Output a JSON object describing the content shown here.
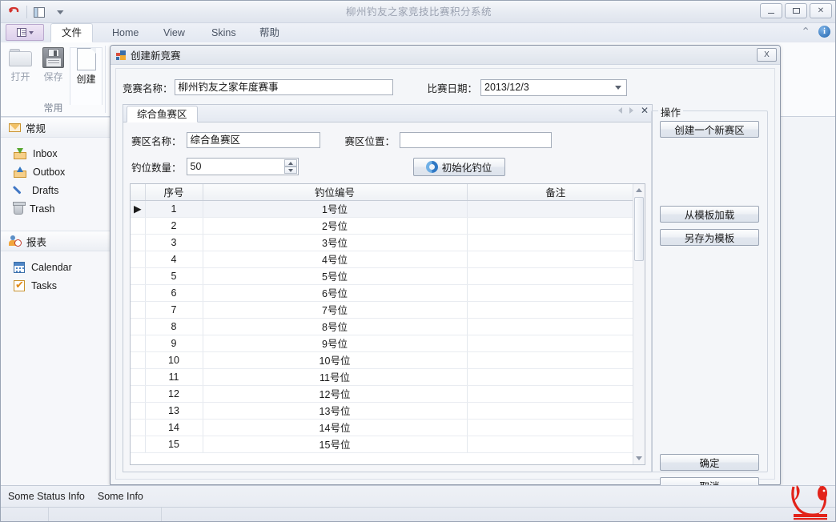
{
  "window": {
    "title": "柳州钓友之家竞技比赛积分系统",
    "minimize_label": "_",
    "maximize_label": "□",
    "close_label": "✕"
  },
  "quick_access": {
    "undo_icon": "undo-icon",
    "window_icon": "window-icon",
    "more_icon": "chevron-down-icon"
  },
  "ribbon": {
    "app_menu_label": "",
    "tabs": [
      {
        "label": "文件",
        "active": true
      },
      {
        "label": "Home",
        "active": false
      },
      {
        "label": "View",
        "active": false
      },
      {
        "label": "Skins",
        "active": false
      },
      {
        "label": "帮助",
        "active": false
      }
    ],
    "collapse_icon": "chevron-up-icon",
    "help_icon": "info-icon",
    "group": {
      "title": "常用",
      "items": [
        {
          "label": "打开",
          "icon": "folder-open-icon",
          "enabled": false
        },
        {
          "label": "保存",
          "icon": "floppy-disk-icon",
          "enabled": false
        },
        {
          "label": "创建",
          "icon": "new-page-icon",
          "enabled": true
        }
      ]
    }
  },
  "navpane": {
    "groups": [
      {
        "header": "常规",
        "header_icon": "envelope-icon",
        "items": [
          {
            "label": "Inbox",
            "icon": "inbox-icon"
          },
          {
            "label": "Outbox",
            "icon": "outbox-icon"
          },
          {
            "label": "Drafts",
            "icon": "pencil-icon"
          },
          {
            "label": "Trash",
            "icon": "trash-icon"
          }
        ]
      },
      {
        "header": "报表",
        "header_icon": "user-clock-icon",
        "items": [
          {
            "label": "Calendar",
            "icon": "calendar-icon"
          },
          {
            "label": "Tasks",
            "icon": "checkbox-icon"
          }
        ]
      }
    ]
  },
  "dialog": {
    "title": "创建新竞赛",
    "icon": "window-form-icon",
    "close_label": "X",
    "fields": {
      "contest_name_label": "竞赛名称：",
      "contest_name_value": "柳州钓友之家年度赛事",
      "match_date_label": "比赛日期：",
      "match_date_value": "2013/12/3"
    },
    "tabs": [
      {
        "label": "综合鱼赛区",
        "active": true
      }
    ],
    "tab_nav": {
      "prev_icon": "chevron-left-icon",
      "next_icon": "chevron-right-icon",
      "close_icon": "close-icon"
    },
    "zone": {
      "name_label": "赛区名称：",
      "name_value": "综合鱼赛区",
      "location_label": "赛区位置：",
      "location_value": "",
      "count_label": "钓位数量：",
      "count_value": "50",
      "init_button_label": "初始化钓位",
      "init_button_icon": "refresh-icon"
    },
    "grid": {
      "columns": [
        "序号",
        "钓位编号",
        "备注"
      ],
      "current_row_marker": "▶",
      "rows": [
        {
          "no": "1",
          "code": "1号位",
          "note": ""
        },
        {
          "no": "2",
          "code": "2号位",
          "note": ""
        },
        {
          "no": "3",
          "code": "3号位",
          "note": ""
        },
        {
          "no": "4",
          "code": "4号位",
          "note": ""
        },
        {
          "no": "5",
          "code": "5号位",
          "note": ""
        },
        {
          "no": "6",
          "code": "6号位",
          "note": ""
        },
        {
          "no": "7",
          "code": "7号位",
          "note": ""
        },
        {
          "no": "8",
          "code": "8号位",
          "note": ""
        },
        {
          "no": "9",
          "code": "9号位",
          "note": ""
        },
        {
          "no": "10",
          "code": "10号位",
          "note": ""
        },
        {
          "no": "11",
          "code": "11号位",
          "note": ""
        },
        {
          "no": "12",
          "code": "12号位",
          "note": ""
        },
        {
          "no": "13",
          "code": "13号位",
          "note": ""
        },
        {
          "no": "14",
          "code": "14号位",
          "note": ""
        },
        {
          "no": "15",
          "code": "15号位",
          "note": ""
        }
      ],
      "scrollbar": {
        "up_icon": "arrow-up-icon",
        "down_icon": "arrow-down-icon"
      }
    },
    "operations": {
      "title": "操作",
      "new_zone_label": "创建一个新赛区",
      "load_template_label": "从模板加载",
      "save_template_label": "另存为模板",
      "ok_label": "确定",
      "cancel_label": "取消"
    }
  },
  "statusbar": {
    "items": [
      "Some Status Info",
      "Some Info"
    ]
  },
  "brand": {
    "logo_name": "fish-logo",
    "color": "#e2231a"
  }
}
